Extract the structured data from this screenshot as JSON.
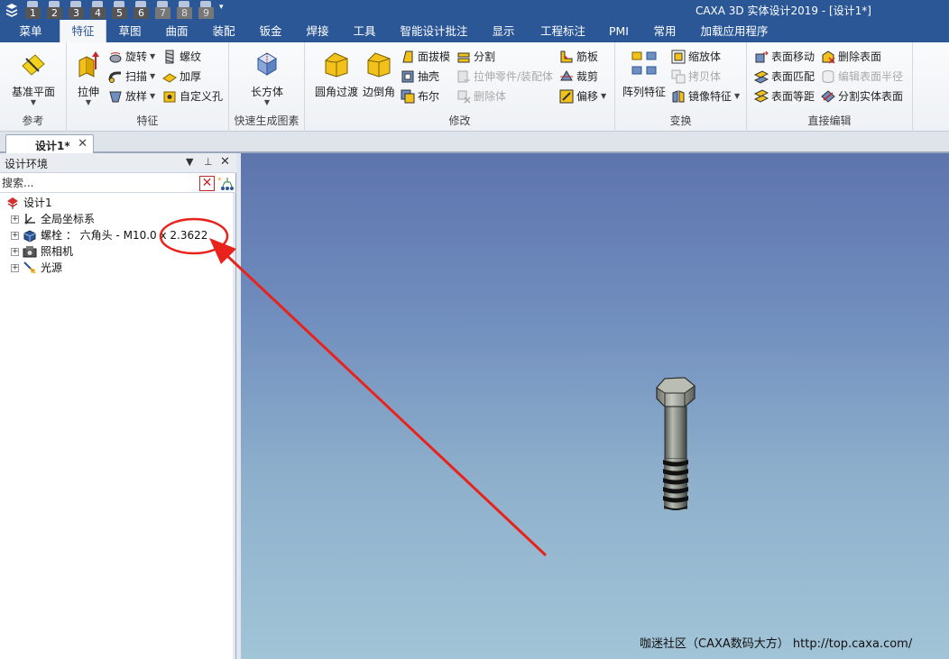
{
  "titlebar": {
    "title": "CAXA 3D 实体设计2019 - [设计1*]",
    "quick_access": [
      "1",
      "2",
      "3",
      "4",
      "5",
      "6",
      "7",
      "8",
      "9"
    ]
  },
  "ribbon_tabs": [
    {
      "label": "菜单"
    },
    {
      "label": "特征"
    },
    {
      "label": "草图"
    },
    {
      "label": "曲面"
    },
    {
      "label": "装配"
    },
    {
      "label": "钣金"
    },
    {
      "label": "焊接"
    },
    {
      "label": "工具"
    },
    {
      "label": "智能设计批注"
    },
    {
      "label": "显示"
    },
    {
      "label": "工程标注"
    },
    {
      "label": "PMI"
    },
    {
      "label": "常用"
    },
    {
      "label": "加载应用程序"
    }
  ],
  "active_tab": "特征",
  "ribbon": {
    "reference": {
      "label": "参考",
      "datum_plane": "基准平面"
    },
    "features": {
      "label": "特征",
      "extrude": "拉伸",
      "revolve": "旋转",
      "sweep": "扫描",
      "loft": "放样",
      "thread": "螺纹",
      "thicken": "加厚",
      "custom_hole": "自定义孔"
    },
    "quick": {
      "label": "快速生成图素",
      "box": "长方体"
    },
    "modify": {
      "label": "修改",
      "fillet": "圆角过渡",
      "chamfer": "边倒角",
      "draft": "面拔模",
      "shell": "抽壳",
      "boolean": "布尔",
      "split": "分割",
      "stretch": "拉伸零件/装配体",
      "delete_body": "删除体",
      "rib": "筋板",
      "trim": "裁剪",
      "offset": "偏移"
    },
    "transform": {
      "label": "变换",
      "pattern": "阵列特征",
      "scale": "缩放体",
      "copy": "拷贝体",
      "mirror": "镜像特征"
    },
    "direct_edit": {
      "label": "直接编辑",
      "face_move": "表面移动",
      "face_match": "表面匹配",
      "face_offset": "表面等距",
      "delete_face": "删除表面",
      "edit_radius": "编辑表面半径",
      "split_face": "分割实体表面"
    }
  },
  "document_tab": {
    "label": "设计1*"
  },
  "panel": {
    "title": "设计环境",
    "search_placeholder": "搜索...",
    "tree": {
      "root": "设计1",
      "items": [
        {
          "label": "全局坐标系"
        },
        {
          "label": "螺栓 ： 六角头 - M10.0 x 2.3622"
        },
        {
          "label": "照相机"
        },
        {
          "label": "光源"
        }
      ]
    }
  },
  "viewport": {
    "watermark": "咖迷社区（CAXA数码大方） http://top.caxa.com/"
  },
  "colors": {
    "title_bar": "#2b5797",
    "annotation": "#e8231c",
    "viewport_top": "#5d74ad",
    "viewport_bottom": "#a2c4d7"
  }
}
